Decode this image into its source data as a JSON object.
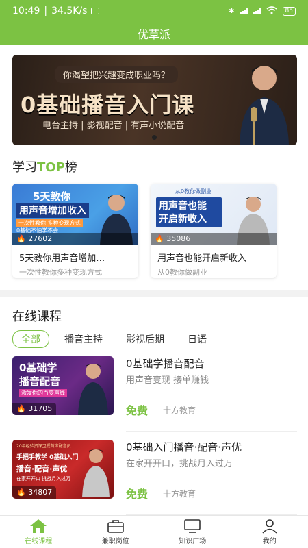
{
  "status_bar": {
    "time": "10:49",
    "speed": "34.5K/s",
    "battery": "85"
  },
  "header": {
    "title": "优草派"
  },
  "banner": {
    "question": "你渴望把兴趣变成职业吗？",
    "headline": "0基础播音入门课",
    "subtitle": "电台主持 | 影视配音 | 有声小说配音"
  },
  "top_section": {
    "title_prefix": "学习",
    "title_highlight": "TOP",
    "title_suffix": "榜"
  },
  "top_cards": [
    {
      "thumb_title1": "5天教你",
      "thumb_title2": "用声音增加收入",
      "thumb_line1": "一次性教你 多种变现方式",
      "thumb_line2": "0基础不怕学不会",
      "count": "27602",
      "title": "5天教你用声音增加…",
      "subtitle": "一次性教你多种变现方式"
    },
    {
      "thumb_tag": "从0教你做副业",
      "thumb_title1": "用声音也能",
      "thumb_title2": "开启新收入",
      "count": "35086",
      "title": "用声音也能开启新收入",
      "subtitle": "从0教你做副业"
    }
  ],
  "online_section": {
    "title": "在线课程"
  },
  "tabs": [
    "全部",
    "播音主持",
    "影视后期",
    "日语"
  ],
  "courses": [
    {
      "thumb_title1": "0基础学",
      "thumb_title2": "播音配音",
      "thumb_tag": "激发你的百变声线",
      "count": "31705",
      "title": "0基础学播音配音",
      "desc": "用声音变现 接单赚钱",
      "price": "免费",
      "org": "十方教育"
    },
    {
      "thumb_top": "20年经验资深卫视首席配音员",
      "thumb_title1": "手把手教学 0基础入门",
      "thumb_title2": "播音·配音·声优",
      "thumb_tag": "在家开开口 挑战月入过万",
      "count": "34807",
      "title": "0基础入门播音·配音·声优",
      "desc": "在家开开口，挑战月入过万",
      "price": "免费",
      "org": "十方教育"
    }
  ],
  "bottom_nav": [
    {
      "label": "在线课程",
      "icon": "home-icon",
      "active": true
    },
    {
      "label": "兼职岗位",
      "icon": "briefcase-icon",
      "active": false
    },
    {
      "label": "知识广场",
      "icon": "monitor-icon",
      "active": false
    },
    {
      "label": "我的",
      "icon": "user-icon",
      "active": false
    }
  ],
  "colors": {
    "accent": "#7cc243",
    "fire": "#ffb300"
  }
}
